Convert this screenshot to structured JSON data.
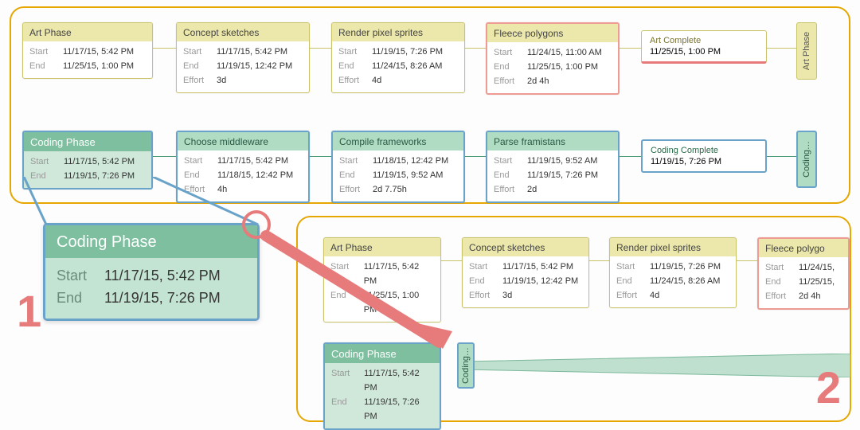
{
  "panel1": {
    "number": "1",
    "lanes": {
      "art": {
        "phase": {
          "title": "Art Phase",
          "start": "11/17/15, 5:42 PM",
          "end": "11/25/15, 1:00 PM"
        },
        "tasks": [
          {
            "title": "Concept sketches",
            "start": "11/17/15, 5:42 PM",
            "end": "11/19/15, 12:42 PM",
            "effort": "3d"
          },
          {
            "title": "Render pixel sprites",
            "start": "11/19/15, 7:26 PM",
            "end": "11/24/15, 8:26 AM",
            "effort": "4d"
          },
          {
            "title": "Fleece polygons",
            "start": "11/24/15, 11:00 AM",
            "end": "11/25/15, 1:00 PM",
            "effort": "2d 4h",
            "highlight": "red"
          }
        ],
        "milestone": {
          "title": "Art Complete",
          "date": "11/25/15, 1:00 PM"
        },
        "endcap": "Art Phase"
      },
      "code": {
        "phase": {
          "title": "Coding Phase",
          "start": "11/17/15, 5:42 PM",
          "end": "11/19/15, 7:26 PM"
        },
        "tasks": [
          {
            "title": "Choose middleware",
            "start": "11/17/15, 5:42 PM",
            "end": "11/18/15, 12:42 PM",
            "effort": "4h"
          },
          {
            "title": "Compile frameworks",
            "start": "11/18/15, 12:42 PM",
            "end": "11/19/15, 9:52 AM",
            "effort": "2d 7.75h"
          },
          {
            "title": "Parse framistans",
            "start": "11/19/15, 9:52 AM",
            "end": "11/19/15, 7:26 PM",
            "effort": "2d"
          }
        ],
        "milestone": {
          "title": "Coding Complete",
          "date": "11/19/15, 7:26 PM"
        },
        "endcap": "Coding…"
      }
    }
  },
  "panel2": {
    "number": "2",
    "lanes": {
      "art": {
        "phase": {
          "title": "Art Phase",
          "start": "11/17/15, 5:42 PM",
          "end": "11/25/15, 1:00 PM"
        },
        "tasks": [
          {
            "title": "Concept sketches",
            "start": "11/17/15, 5:42 PM",
            "end": "11/19/15, 12:42 PM",
            "effort": "3d"
          },
          {
            "title": "Render pixel sprites",
            "start": "11/19/15, 7:26 PM",
            "end": "11/24/15, 8:26 AM",
            "effort": "4d"
          },
          {
            "title": "Fleece polygo",
            "start": "11/24/15,",
            "end": "11/25/15,",
            "effort": "2d 4h",
            "highlight": "red"
          }
        ]
      },
      "code": {
        "phase": {
          "title": "Coding Phase",
          "start": "11/17/15, 5:42 PM",
          "end": "11/19/15, 7:26 PM"
        },
        "endcap": "Coding…"
      }
    }
  },
  "callout": {
    "title": "Coding Phase",
    "start_label": "Start",
    "end_label": "End",
    "start": "11/17/15, 5:42 PM",
    "end": "11/19/15, 7:26 PM"
  },
  "labels": {
    "start": "Start",
    "end": "End",
    "effort": "Effort"
  }
}
